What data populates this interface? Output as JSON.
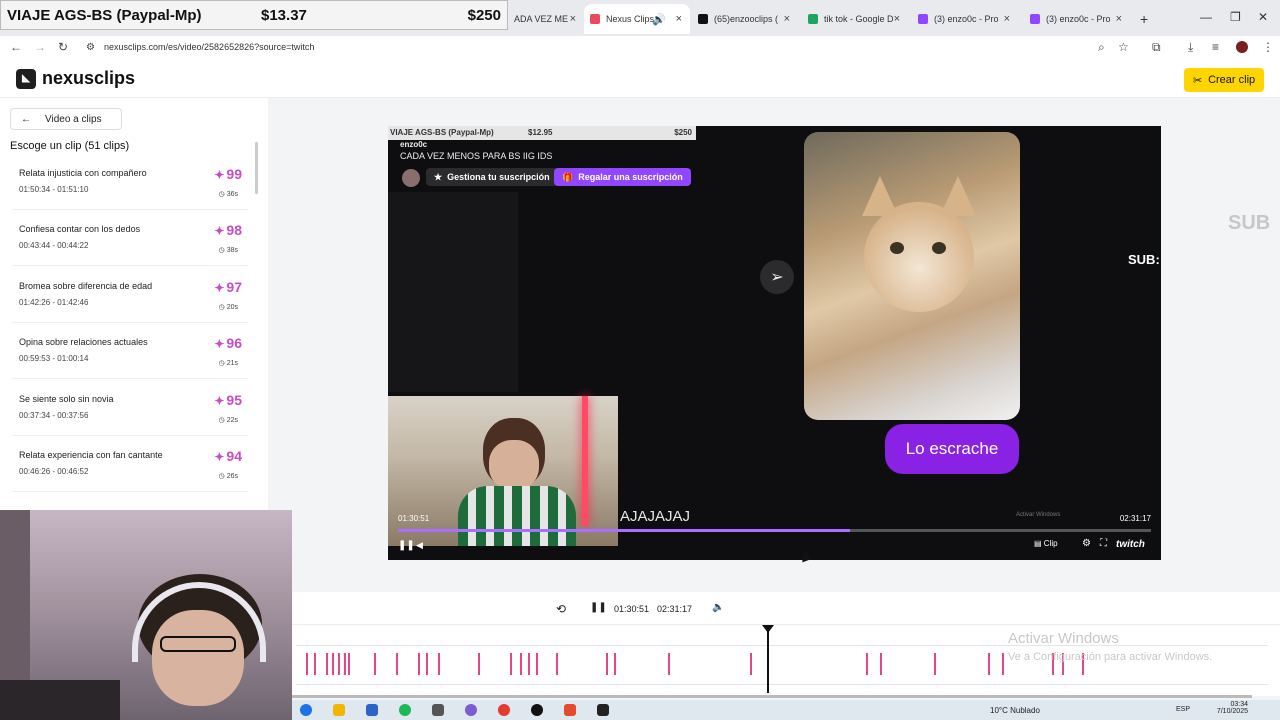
{
  "overlay_banner": {
    "goal": "VIAJE AGS-BS (Paypal-Mp)",
    "amount": "$13.37",
    "target": "$250"
  },
  "tabs": [
    {
      "label": "ADA VEZ ME",
      "active": false
    },
    {
      "label": "Nexus Clips",
      "active": true
    },
    {
      "label": "(65)enzooclips (",
      "active": false
    },
    {
      "label": "tik tok - Google D",
      "active": false
    },
    {
      "label": "(3) enzo0c - Pro",
      "active": false
    },
    {
      "label": "(3) enzo0c - Pro",
      "active": false
    }
  ],
  "new_tab": "+",
  "url": "nexusclips.com/es/video/2582652826?source=twitch",
  "app": {
    "logo": "nexusclips",
    "create_button": "Crear clip"
  },
  "sidebar": {
    "back_label": "Video a clips",
    "heading": "Escoge un clip (51 clips)",
    "clips": [
      {
        "title": "Relata injusticia con compañero",
        "range": "01:50:34 - 01:51:10",
        "score": "99",
        "duration": "36s"
      },
      {
        "title": "Confiesa contar con los dedos",
        "range": "00:43:44 - 00:44:22",
        "score": "98",
        "duration": "38s"
      },
      {
        "title": "Bromea sobre diferencia de edad",
        "range": "01:42:26 - 01:42:46",
        "score": "97",
        "duration": "20s"
      },
      {
        "title": "Opina sobre relaciones actuales",
        "range": "00:59:53 - 01:00:14",
        "score": "96",
        "duration": "21s"
      },
      {
        "title": "Se siente solo sin novia",
        "range": "00:37:34 - 00:37:56",
        "score": "95",
        "duration": "22s"
      },
      {
        "title": "Relata experiencia con fan cantante",
        "range": "00:46:26 - 00:46:52",
        "score": "94",
        "duration": "26s"
      }
    ]
  },
  "player": {
    "mini_banner_goal": "VIAJE AGS-BS (Paypal-Mp)",
    "mini_banner_amount": "$12.95",
    "mini_banner_target": "$250",
    "streamer": "enzo0c",
    "stream_title": "CADA VEZ MENOS PARA BS IIG IDS",
    "sub_button": "Gestiona tu suscripción",
    "gift_button": "Regalar una suscripción",
    "bubble_text": "Lo escrache",
    "caption": "AJAJAJAJ",
    "time_current": "01:30:51",
    "time_total": "02:31:17",
    "progress": 0.6,
    "clip_label": "Clip",
    "brand": "twitch",
    "activate_small": "Activar Windows"
  },
  "side_text": {
    "sub_large": "SUB",
    "sub_small": "SUB:"
  },
  "controls": {
    "time_current": "01:30:51",
    "time_total": "02:31:17"
  },
  "timeline": {
    "markers_count": 30
  },
  "watermark": {
    "line1": "Activar Windows",
    "line2": "Ve a Configuración para activar Windows."
  },
  "taskbar": {
    "weather": "10°C Nublado",
    "language": "ESP",
    "time": "03:34",
    "date": "7/10/2025"
  },
  "colors": {
    "accent": "#ffd500",
    "score": "#c84dc4",
    "twitch": "#9147ff",
    "bubble": "#8a22e6",
    "marker": "#e8468c"
  }
}
